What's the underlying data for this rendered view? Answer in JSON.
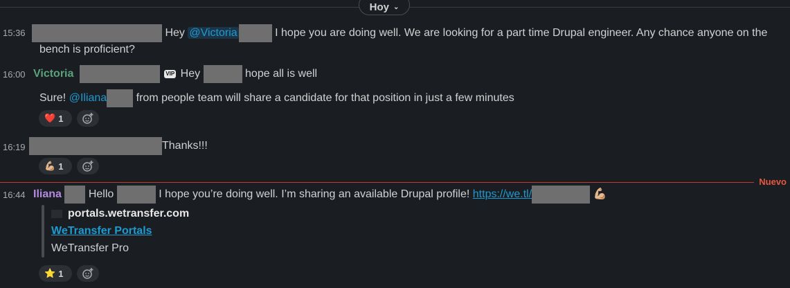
{
  "day_divider": {
    "label": "Hoy"
  },
  "messages": [
    {
      "time": "15:36",
      "text_a": "Hey",
      "mention": "@Victoria",
      "text_b": "I hope you are doing well. We are looking for a part time Drupal engineer. Any chance anyone on the",
      "text_c": "bench is proficient?"
    },
    {
      "time": "16:00",
      "sender": "Victoria",
      "badge": "VIP",
      "text_a": "Hey",
      "text_b": "hope all is well",
      "line2_a": "Sure!",
      "mention": "@Iliana",
      "line2_b": "from people team will share a candidate for that position in just a few minutes",
      "reaction": {
        "emoji": "❤️",
        "count": "1"
      }
    },
    {
      "time": "16:19",
      "text": "Thanks!!!",
      "reaction": {
        "emoji": "💪🏼",
        "count": "1"
      }
    },
    {
      "time": "16:44",
      "sender": "Iliana",
      "text_a": "Hello",
      "text_b": "I hope you’re doing well. I’m sharing an available Drupal profile!",
      "link": "https://we.tl/",
      "emoji": "💪🏼",
      "preview": {
        "site": "portals.wetransfer.com",
        "title": "WeTransfer Portals",
        "description": "WeTransfer Pro"
      },
      "reaction": {
        "emoji": "⭐",
        "count": "1"
      }
    }
  ],
  "new_marker": "Nuevo",
  "colors": {
    "background": "#1a1d21",
    "mention": "#1d9bd1",
    "new": "#e8573f"
  }
}
